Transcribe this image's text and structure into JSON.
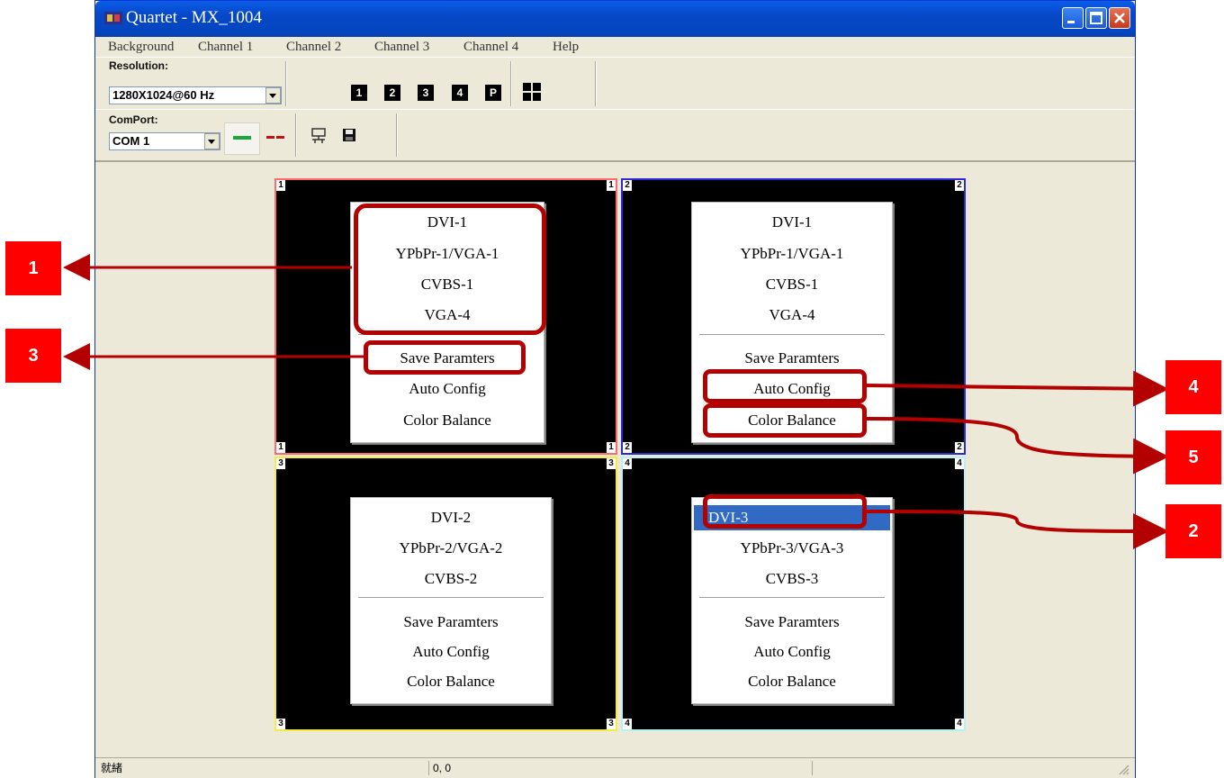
{
  "window": {
    "title": "Quartet - MX_1004"
  },
  "menu": [
    "Background",
    "Channel 1",
    "Channel 2",
    "Channel 3",
    "Channel 4",
    "Help"
  ],
  "toolbar": {
    "resolution_label": "Resolution:",
    "resolution_value": "1280X1024@60 Hz",
    "channel_buttons": [
      "1",
      "2",
      "3",
      "4",
      "P"
    ],
    "comport_label": "ComPort:",
    "comport_value": "COM 1"
  },
  "panes": [
    {
      "number": "1",
      "border_color": "#ff6a6a",
      "menu": {
        "sources": [
          "DVI-1",
          "YPbPr-1/VGA-1",
          "CVBS-1",
          "VGA-4"
        ],
        "actions": [
          "Save Paramters",
          "Auto Config",
          "Color Balance"
        ]
      }
    },
    {
      "number": "2",
      "border_color": "#2b2bd6",
      "menu": {
        "sources": [
          "DVI-1",
          "YPbPr-1/VGA-1",
          "CVBS-1",
          "VGA-4"
        ],
        "actions": [
          "Save Paramters",
          "Auto Config",
          "Color Balance"
        ]
      }
    },
    {
      "number": "3",
      "border_color": "#f4ea4a",
      "menu": {
        "sources": [
          "DVI-2",
          "YPbPr-2/VGA-2",
          "CVBS-2"
        ],
        "actions": [
          "Save Paramters",
          "Auto Config",
          "Color Balance"
        ]
      }
    },
    {
      "number": "4",
      "border_color": "#b7f2f2",
      "menu": {
        "sources": [
          "DVI-3",
          "YPbPr-3/VGA-3",
          "CVBS-3"
        ],
        "actions": [
          "Save Paramters",
          "Auto Config",
          "Color Balance"
        ],
        "selected": "DVI-3"
      }
    }
  ],
  "callouts": [
    "1",
    "3",
    "4",
    "5",
    "2"
  ],
  "statusbar": {
    "ready": "就緒",
    "coords": "0, 0"
  },
  "colors": {
    "callout": "#ff0000",
    "highlight": "#b30000",
    "titlebar": "#0747c7",
    "selection": "#316ac5"
  }
}
